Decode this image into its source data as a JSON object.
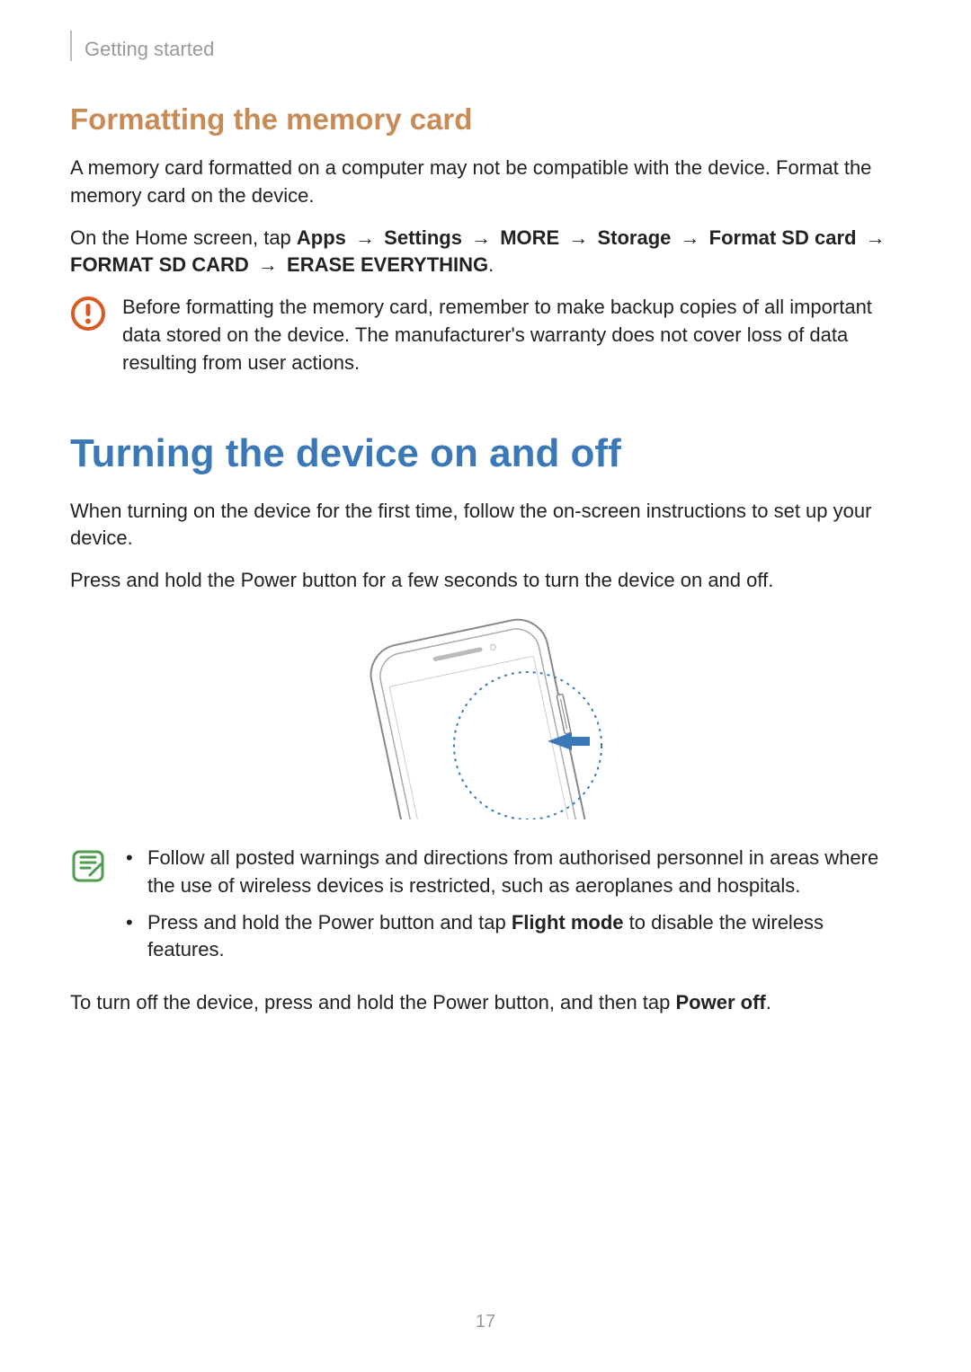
{
  "header": {
    "chapter": "Getting started"
  },
  "section1": {
    "heading": "Formatting the memory card",
    "para1": "A memory card formatted on a computer may not be compatible with the device. Format the memory card on the device.",
    "path_intro": "On the Home screen, tap ",
    "path_steps": [
      "Apps",
      "Settings",
      "MORE",
      "Storage",
      "Format SD card",
      "FORMAT SD CARD",
      "ERASE EVERYTHING"
    ],
    "arrow": "→",
    "period": ".",
    "warning": "Before formatting the memory card, remember to make backup copies of all important data stored on the device. The manufacturer's warranty does not cover loss of data resulting from user actions."
  },
  "section2": {
    "heading": "Turning the device on and off",
    "para1": "When turning on the device for the first time, follow the on-screen instructions to set up your device.",
    "para2": "Press and hold the Power button for a few seconds to turn the device on and off.",
    "note_bullet1": "Follow all posted warnings and directions from authorised personnel in areas where the use of wireless devices is restricted, such as aeroplanes and hospitals.",
    "note_bullet2_pre": "Press and hold the Power button and tap ",
    "note_bullet2_bold": "Flight mode",
    "note_bullet2_post": " to disable the wireless features.",
    "para3_pre": "To turn off the device, press and hold the Power button, and then tap ",
    "para3_bold": "Power off",
    "para3_post": "."
  },
  "page_number": "17"
}
